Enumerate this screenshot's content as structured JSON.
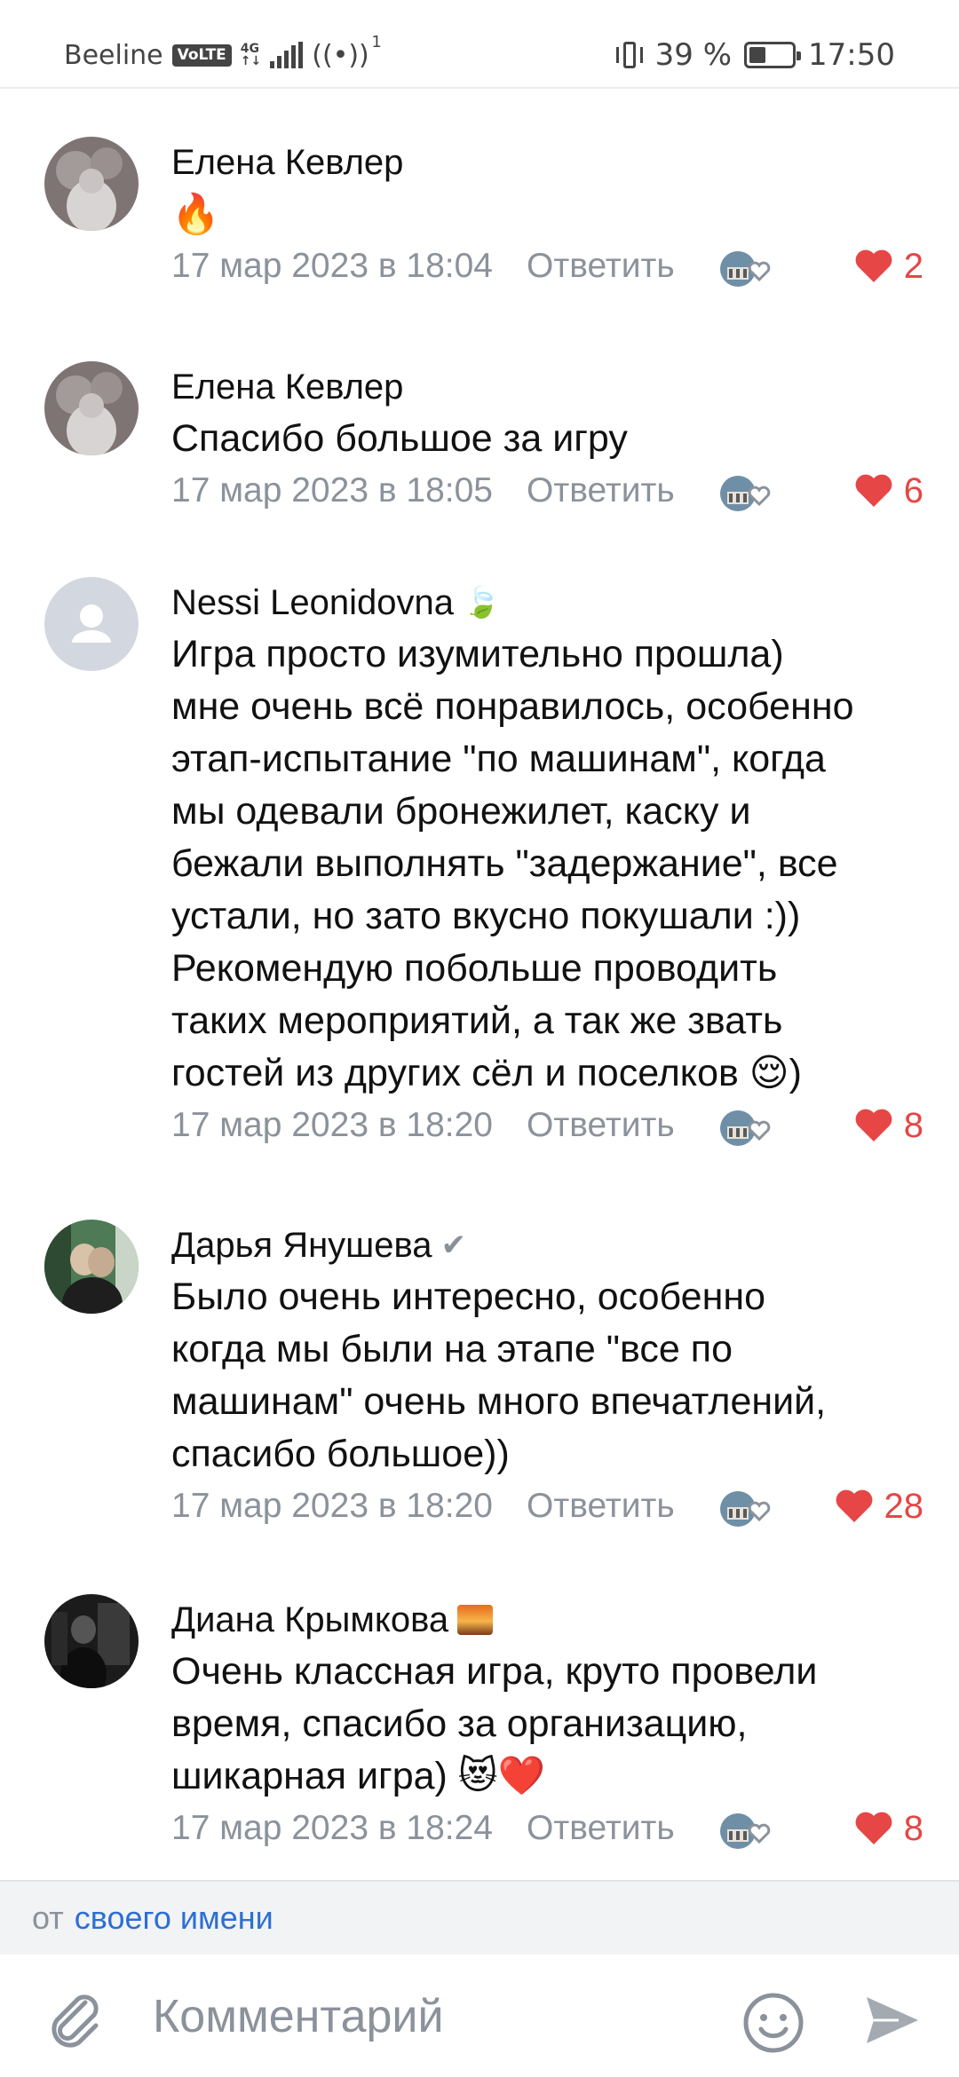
{
  "status_bar": {
    "carrier": "Beeline",
    "volte": "VoLTE",
    "network": "4G",
    "hotspot_count": "1",
    "battery_text": "39 %",
    "battery_level": 0.39,
    "time": "17:50"
  },
  "comments": [
    {
      "author": "Елена Кевлер",
      "text": "🔥",
      "date": "17 мар 2023 в 18:04",
      "reply": "Ответить",
      "likes": "2"
    },
    {
      "author": "Елена Кевлер",
      "text": "Спасибо большое за игру",
      "date": "17 мар 2023 в 18:05",
      "reply": "Ответить",
      "likes": "6"
    },
    {
      "author": "Nessi Leonidovna",
      "badge": "🍃",
      "text": "Игра просто изумительно прошла)\nмне очень всё понравилось, особенно\nэтап-испытание \"по машинам\", когда\nмы одевали бронежилет, каску и\nбежали выполнять \"задержание\", все\nустали, но зато вкусно покушали :))\nРекомендую побольше проводить\nтаких мероприятий, а так же звать\nгостей из других сёл и поселков 😌)",
      "date": "17 мар 2023 в 18:20",
      "reply": "Ответить",
      "likes": "8"
    },
    {
      "author": "Дарья Янушева",
      "badge": "✔",
      "text": "Было очень интересно, особенно\nкогда мы были на этапе \"все по\nмашинам\" очень много впечатлений,\nспасибо большое))",
      "date": "17 мар 2023 в 18:20",
      "reply": "Ответить",
      "likes": "28"
    },
    {
      "author": "Диана Крымкова",
      "text": "Очень классная игра, круто провели\nвремя, спасибо за организацию,\nшикарная игра) 😻❤️",
      "date": "17 мар 2023 в 18:24",
      "reply": "Ответить",
      "likes": "8"
    }
  ],
  "author_bar": {
    "prefix": "от",
    "link": "своего имени"
  },
  "composer": {
    "placeholder": "Комментарий"
  },
  "icons": {
    "attach": "paperclip-icon",
    "emoji": "smile-icon",
    "send": "send-icon",
    "like": "heart-icon",
    "reaction": "reaction-like-icon"
  },
  "colors": {
    "like": "#e64646",
    "link": "#2c6fd3",
    "meta": "#8b929b"
  }
}
